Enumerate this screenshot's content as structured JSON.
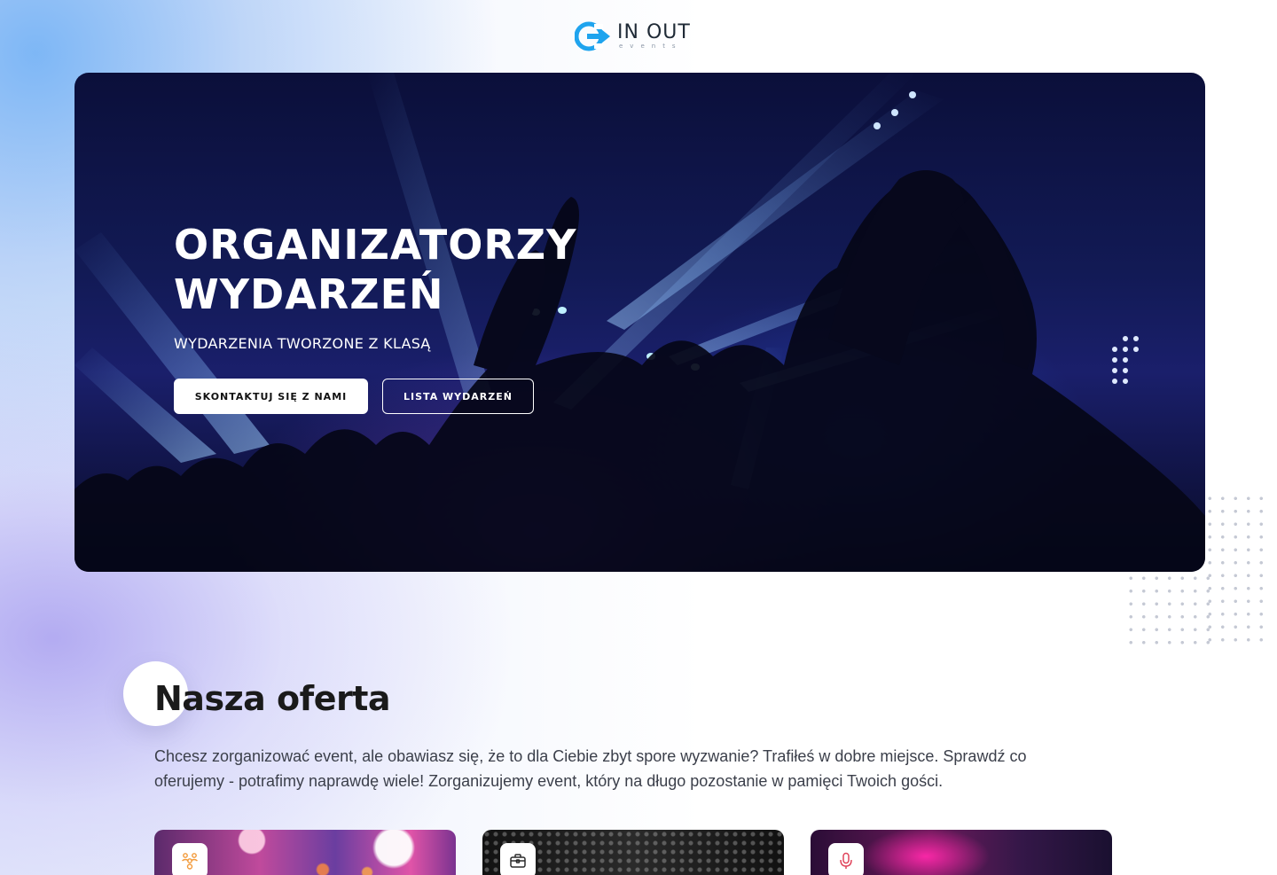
{
  "header": {
    "logo_main": "IN OUT",
    "logo_sub": "events"
  },
  "hero": {
    "title": "ORGANIZATORZY\nWYDARZEŃ",
    "subtitle": "WYDARZENIA TWORZONE Z KLASĄ",
    "primary_button": "SKONTAKTUJ SIĘ Z NAMI",
    "secondary_button": "LISTA WYDARZEŃ"
  },
  "offer": {
    "title": "Nasza oferta",
    "description": "Chcesz zorganizować event, ale obawiasz się, że to dla Ciebie zbyt spore wyzwanie? Trafiłeś w dobre miejsce. Sprawdź co oferujemy - potrafimy naprawdę wiele! Zorganizujemy event, który na długo pozostanie w pamięci Twoich gości.",
    "cards": [
      {
        "icon": "people-icon",
        "icon_color": "#f29a3a"
      },
      {
        "icon": "briefcase-icon",
        "icon_color": "#2b2b2b"
      },
      {
        "icon": "microphone-icon",
        "icon_color": "#e0435a"
      }
    ]
  },
  "colors": {
    "logo_blue": "#1fa4ee",
    "hero_dark": "#0b0f3a",
    "text_dark": "#1a1a1a"
  }
}
